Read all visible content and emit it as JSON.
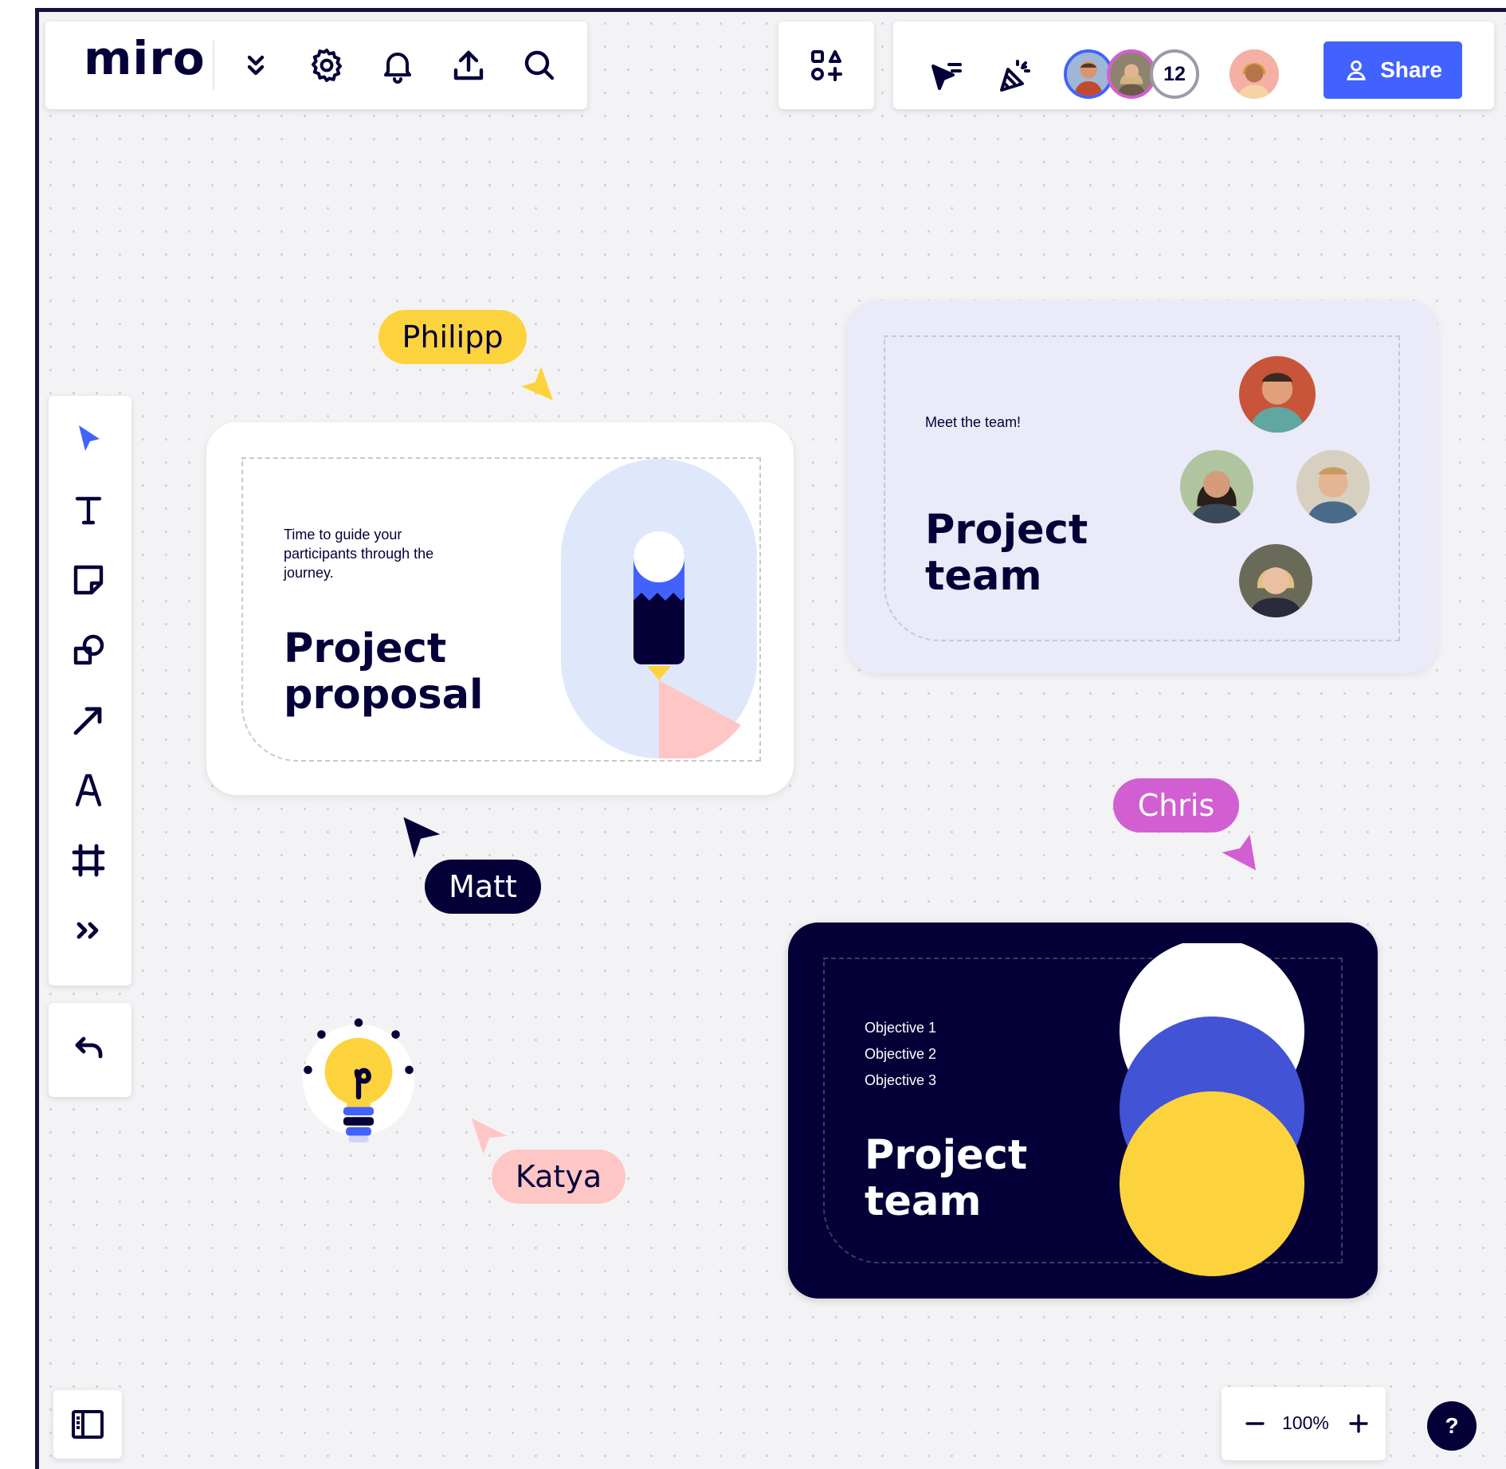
{
  "app": {
    "logo": "miro"
  },
  "toolbar": {
    "left_icons": [
      "chevrons-down-icon",
      "gear-icon",
      "bell-icon",
      "upload-icon",
      "search-icon"
    ],
    "apps_icon": "apps-icon",
    "right_icons": [
      "cursor-follow-icon",
      "celebrate-icon"
    ],
    "collaborators_count": "12",
    "share_label": "Share"
  },
  "left_tools": [
    "select-icon",
    "text-icon",
    "sticky-note-icon",
    "shapes-icon",
    "arrow-icon",
    "pen-icon",
    "frame-icon",
    "more-icon"
  ],
  "cards": {
    "proposal": {
      "subtitle": "Time to guide your participants through the journey.",
      "title_line1": "Project",
      "title_line2": "proposal"
    },
    "team_light": {
      "subtitle": "Meet the team!",
      "title_line1": "Project",
      "title_line2": "team"
    },
    "team_dark": {
      "objectives": [
        "Objective 1",
        "Objective 2",
        "Objective 3"
      ],
      "title_line1": "Project",
      "title_line2": "team"
    }
  },
  "cursors": {
    "philipp": {
      "name": "Philipp",
      "color": "#fdd33d"
    },
    "matt": {
      "name": "Matt",
      "color": "#050038"
    },
    "chris": {
      "name": "Chris",
      "color": "#d25fd2"
    },
    "katya": {
      "name": "Katya",
      "color": "#ffc6c6"
    }
  },
  "bottom": {
    "zoom_level": "100%",
    "help_label": "?"
  },
  "colors": {
    "accent": "#4262ff",
    "dark_navy": "#050038",
    "yellow": "#fdd33d",
    "pink": "#ffc6c6",
    "light_lavender": "#eaeaf8"
  }
}
